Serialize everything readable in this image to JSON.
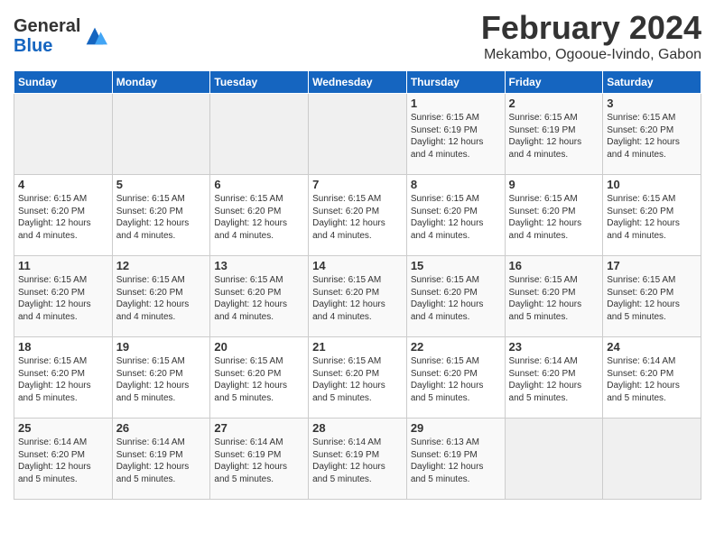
{
  "header": {
    "logo_general": "General",
    "logo_blue": "Blue",
    "month": "February 2024",
    "location": "Mekambo, Ogooue-Ivindo, Gabon"
  },
  "days_of_week": [
    "Sunday",
    "Monday",
    "Tuesday",
    "Wednesday",
    "Thursday",
    "Friday",
    "Saturday"
  ],
  "weeks": [
    [
      {
        "day": "",
        "info": ""
      },
      {
        "day": "",
        "info": ""
      },
      {
        "day": "",
        "info": ""
      },
      {
        "day": "",
        "info": ""
      },
      {
        "day": "1",
        "info": "Sunrise: 6:15 AM\nSunset: 6:19 PM\nDaylight: 12 hours\nand 4 minutes."
      },
      {
        "day": "2",
        "info": "Sunrise: 6:15 AM\nSunset: 6:19 PM\nDaylight: 12 hours\nand 4 minutes."
      },
      {
        "day": "3",
        "info": "Sunrise: 6:15 AM\nSunset: 6:20 PM\nDaylight: 12 hours\nand 4 minutes."
      }
    ],
    [
      {
        "day": "4",
        "info": "Sunrise: 6:15 AM\nSunset: 6:20 PM\nDaylight: 12 hours\nand 4 minutes."
      },
      {
        "day": "5",
        "info": "Sunrise: 6:15 AM\nSunset: 6:20 PM\nDaylight: 12 hours\nand 4 minutes."
      },
      {
        "day": "6",
        "info": "Sunrise: 6:15 AM\nSunset: 6:20 PM\nDaylight: 12 hours\nand 4 minutes."
      },
      {
        "day": "7",
        "info": "Sunrise: 6:15 AM\nSunset: 6:20 PM\nDaylight: 12 hours\nand 4 minutes."
      },
      {
        "day": "8",
        "info": "Sunrise: 6:15 AM\nSunset: 6:20 PM\nDaylight: 12 hours\nand 4 minutes."
      },
      {
        "day": "9",
        "info": "Sunrise: 6:15 AM\nSunset: 6:20 PM\nDaylight: 12 hours\nand 4 minutes."
      },
      {
        "day": "10",
        "info": "Sunrise: 6:15 AM\nSunset: 6:20 PM\nDaylight: 12 hours\nand 4 minutes."
      }
    ],
    [
      {
        "day": "11",
        "info": "Sunrise: 6:15 AM\nSunset: 6:20 PM\nDaylight: 12 hours\nand 4 minutes."
      },
      {
        "day": "12",
        "info": "Sunrise: 6:15 AM\nSunset: 6:20 PM\nDaylight: 12 hours\nand 4 minutes."
      },
      {
        "day": "13",
        "info": "Sunrise: 6:15 AM\nSunset: 6:20 PM\nDaylight: 12 hours\nand 4 minutes."
      },
      {
        "day": "14",
        "info": "Sunrise: 6:15 AM\nSunset: 6:20 PM\nDaylight: 12 hours\nand 4 minutes."
      },
      {
        "day": "15",
        "info": "Sunrise: 6:15 AM\nSunset: 6:20 PM\nDaylight: 12 hours\nand 4 minutes."
      },
      {
        "day": "16",
        "info": "Sunrise: 6:15 AM\nSunset: 6:20 PM\nDaylight: 12 hours\nand 5 minutes."
      },
      {
        "day": "17",
        "info": "Sunrise: 6:15 AM\nSunset: 6:20 PM\nDaylight: 12 hours\nand 5 minutes."
      }
    ],
    [
      {
        "day": "18",
        "info": "Sunrise: 6:15 AM\nSunset: 6:20 PM\nDaylight: 12 hours\nand 5 minutes."
      },
      {
        "day": "19",
        "info": "Sunrise: 6:15 AM\nSunset: 6:20 PM\nDaylight: 12 hours\nand 5 minutes."
      },
      {
        "day": "20",
        "info": "Sunrise: 6:15 AM\nSunset: 6:20 PM\nDaylight: 12 hours\nand 5 minutes."
      },
      {
        "day": "21",
        "info": "Sunrise: 6:15 AM\nSunset: 6:20 PM\nDaylight: 12 hours\nand 5 minutes."
      },
      {
        "day": "22",
        "info": "Sunrise: 6:15 AM\nSunset: 6:20 PM\nDaylight: 12 hours\nand 5 minutes."
      },
      {
        "day": "23",
        "info": "Sunrise: 6:14 AM\nSunset: 6:20 PM\nDaylight: 12 hours\nand 5 minutes."
      },
      {
        "day": "24",
        "info": "Sunrise: 6:14 AM\nSunset: 6:20 PM\nDaylight: 12 hours\nand 5 minutes."
      }
    ],
    [
      {
        "day": "25",
        "info": "Sunrise: 6:14 AM\nSunset: 6:20 PM\nDaylight: 12 hours\nand 5 minutes."
      },
      {
        "day": "26",
        "info": "Sunrise: 6:14 AM\nSunset: 6:19 PM\nDaylight: 12 hours\nand 5 minutes."
      },
      {
        "day": "27",
        "info": "Sunrise: 6:14 AM\nSunset: 6:19 PM\nDaylight: 12 hours\nand 5 minutes."
      },
      {
        "day": "28",
        "info": "Sunrise: 6:14 AM\nSunset: 6:19 PM\nDaylight: 12 hours\nand 5 minutes."
      },
      {
        "day": "29",
        "info": "Sunrise: 6:13 AM\nSunset: 6:19 PM\nDaylight: 12 hours\nand 5 minutes."
      },
      {
        "day": "",
        "info": ""
      },
      {
        "day": "",
        "info": ""
      }
    ]
  ]
}
